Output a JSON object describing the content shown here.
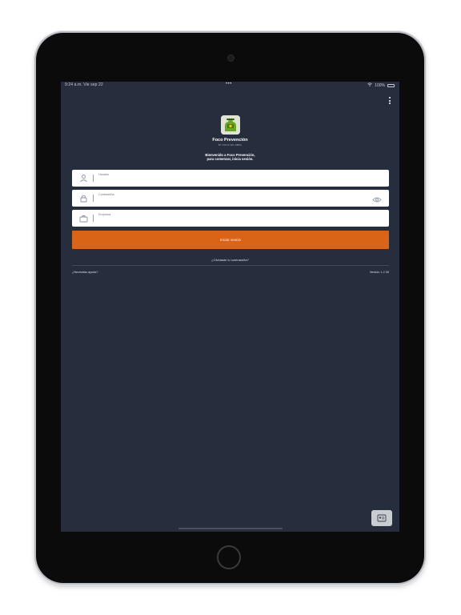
{
  "statusbar": {
    "time": "9:24 a.m.  Vie sep 22",
    "dots": "•••",
    "battery_text": "100%"
  },
  "brand": {
    "name": "Foco Prevención",
    "subtitle": "BY FOCO EN OBRA"
  },
  "welcome": {
    "line1": "Bienvenido a Foco Prevención,",
    "line2": "para comenzar, inicia sesión."
  },
  "form": {
    "user_label": "Usuario",
    "password_label": "Contraseña",
    "company_label": "Empresa",
    "login_label": "Iniciar sesión"
  },
  "footer": {
    "forgot": "¿Olvidaste tu contraseña?",
    "help": "¿Necesitas ayuda?",
    "version": "Versión 1.2.35"
  },
  "icons": {
    "user": "user-icon",
    "lock": "lock-icon",
    "briefcase": "briefcase-icon",
    "eye": "eye-icon",
    "menu": "kebab-menu-icon",
    "corner": "id-card-icon"
  },
  "colors": {
    "background": "#262d3d",
    "accent": "#d96418",
    "logo_green": "#6aa522"
  }
}
